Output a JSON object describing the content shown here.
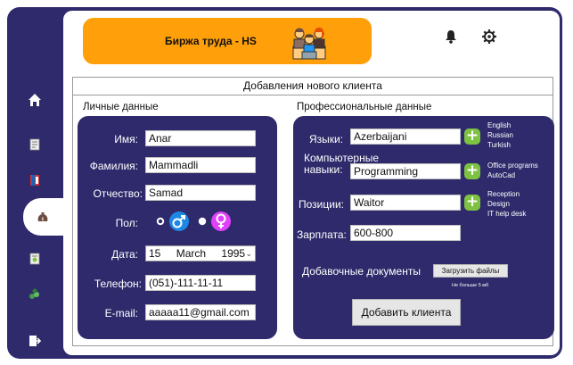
{
  "header": {
    "title": "Биржа труда - HS",
    "notifications_icon": "bell-icon",
    "settings_icon": "gear-icon",
    "banner_color": "#ff9f0a"
  },
  "sidebar": {
    "background": "#2e2a6b",
    "items": [
      {
        "icon": "home-icon"
      },
      {
        "icon": "document-icon"
      },
      {
        "icon": "book-icon"
      },
      {
        "icon": "money-bag-icon",
        "active": true
      },
      {
        "icon": "report-icon"
      },
      {
        "icon": "cash-icon"
      },
      {
        "icon": "logout-icon"
      }
    ]
  },
  "form": {
    "title": "Добавления нового клиента",
    "personal": {
      "section_title": "Личные данные",
      "name_label": "Имя:",
      "name_value": "Anar",
      "surname_label": "Фамилия:",
      "surname_value": "Mammadli",
      "patronymic_label": "Отчество:",
      "patronymic_value": "Samad",
      "gender_label": "Пол:",
      "gender_selected": "male",
      "date_label": "Дата:",
      "date_day": "15",
      "date_month": "March",
      "date_year": "1995",
      "phone_label": "Телефон:",
      "phone_value": "(051)-111-11-11",
      "email_label": "E-mail:",
      "email_value": "aaaaa11@gmail.com"
    },
    "professional": {
      "section_title": "Профессиональные данные",
      "languages_label": "Языки:",
      "languages_value": "Azerbaijani",
      "languages_list": [
        "English",
        "Russian",
        "Turkish"
      ],
      "skills_label_line1": "Компьютерные",
      "skills_label_line2": "навыки:",
      "skills_value": "Programming",
      "skills_list": [
        "Office programs",
        "AutoCad"
      ],
      "positions_label": "Позиции:",
      "positions_value": "Waitor",
      "positions_list": [
        "Reception",
        "Design",
        "IT help desk"
      ],
      "salary_label": "Зарплата:",
      "salary_value": "600-800",
      "documents_label": "Добавочные документы",
      "upload_button": "Загрузить файлы",
      "upload_note": "Не больше 5 мб",
      "submit_button": "Добавить клиента"
    }
  },
  "colors": {
    "primary": "#2e2a6b",
    "accent_green": "#7ec242",
    "male_symbol": "#1e88e5",
    "female_symbol": "#e040fb"
  }
}
